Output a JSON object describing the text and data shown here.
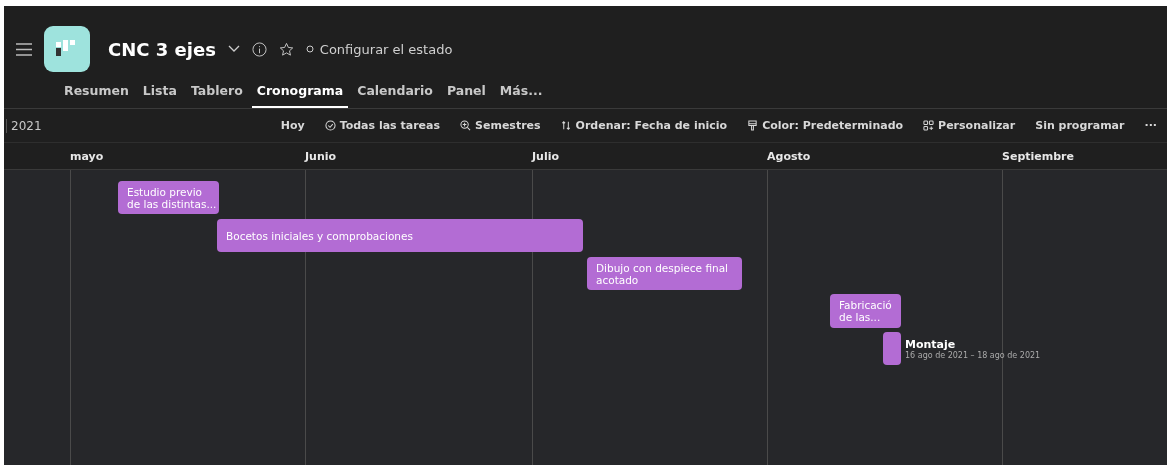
{
  "project": {
    "title": "CNC 3 ejes",
    "status": "Configurar el estado"
  },
  "tabs": [
    {
      "label": "Resumen",
      "selected": false
    },
    {
      "label": "Lista",
      "selected": false
    },
    {
      "label": "Tablero",
      "selected": false
    },
    {
      "label": "Cronograma",
      "selected": true
    },
    {
      "label": "Calendario",
      "selected": false
    },
    {
      "label": "Panel",
      "selected": false
    },
    {
      "label": "Más...",
      "selected": false
    }
  ],
  "toolbar": {
    "year": "2021",
    "actions": [
      {
        "kind": "plain",
        "label": "Hoy"
      },
      {
        "kind": "check",
        "label": "Todas las tareas"
      },
      {
        "kind": "zoom",
        "label": "Semestres"
      },
      {
        "kind": "sort",
        "label": "Ordenar: Fecha de inicio"
      },
      {
        "kind": "paint",
        "label": "Color: Predeterminado"
      },
      {
        "kind": "custom",
        "label": "Personalizar"
      },
      {
        "kind": "plain",
        "label": "Sin programar"
      },
      {
        "kind": "more",
        "label": "···"
      }
    ]
  },
  "months": [
    "mayo",
    "Junio",
    "Julio",
    "Agosto",
    "Septiembre"
  ],
  "tasks": [
    {
      "kind": "inside",
      "lines": [
        "Estudio previo",
        "de las distintas..."
      ]
    },
    {
      "kind": "inside",
      "lines": [
        "Bocetos iniciales y comprobaciones"
      ]
    },
    {
      "kind": "inside",
      "lines": [
        "Dibujo con despiece final",
        "acotado"
      ]
    },
    {
      "kind": "inside",
      "lines": [
        "Fabricació",
        "de las..."
      ]
    },
    {
      "kind": "outside",
      "lines": [
        "Montaje"
      ],
      "dates": "16 ago de 2021 – 18 ago de 2021"
    }
  ]
}
